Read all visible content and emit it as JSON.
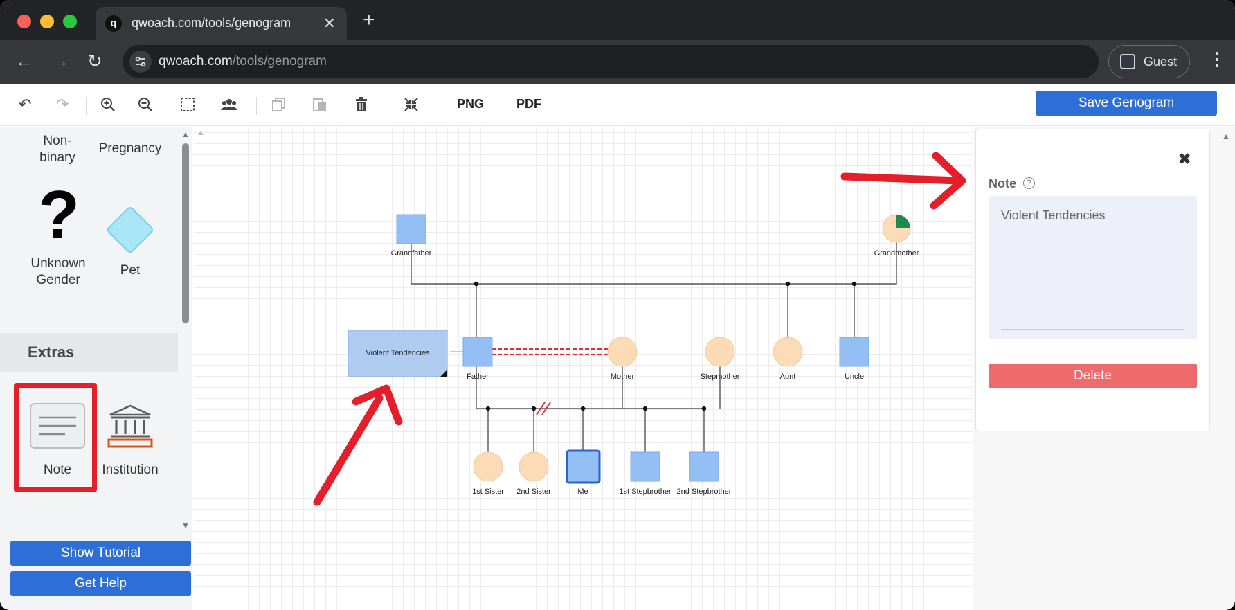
{
  "browser": {
    "tab_title": "qwoach.com/tools/genogram",
    "tab_favicon": "q",
    "url_host": "qwoach.com",
    "url_path": "/tools/genogram",
    "profile_label": "Guest"
  },
  "toolbar": {
    "png_label": "PNG",
    "pdf_label": "PDF",
    "save_label": "Save Genogram",
    "icons": [
      "undo-icon",
      "redo-icon",
      "zoom-in-icon",
      "zoom-out-icon",
      "select-icon",
      "group-icon",
      "copy-icon",
      "paste-icon",
      "trash-icon",
      "fit-icon"
    ]
  },
  "palette": {
    "nonbinary_label": "Non-\nbinary",
    "pregnancy_label": "Pregnancy",
    "unknown_label": "Unknown\nGender",
    "pet_label": "Pet",
    "extras_title": "Extras",
    "note_label": "Note",
    "institution_label": "Institution",
    "tutorial_label": "Show Tutorial",
    "help_label": "Get Help"
  },
  "genogram": {
    "note_text": "Violent Tendencies",
    "people": {
      "grandfather": "Grandfather",
      "grandmother": "Grandmother",
      "father": "Father",
      "mother": "Mother",
      "stepmother": "Stepmother",
      "aunt": "Aunt",
      "uncle": "Uncle",
      "sister1": "1st Sister",
      "sister2": "2nd Sister",
      "me": "Me",
      "stepbrother1": "1st Stepbrother",
      "stepbrother2": "2nd Stepbrother"
    }
  },
  "note_panel": {
    "label": "Note",
    "value": "Violent Tendencies",
    "delete_label": "Delete"
  },
  "colors": {
    "male_fill": "#94bff5",
    "female_fill": "#fbdcb6",
    "accent_blue": "#2d6fd6",
    "delete_red": "#ef6b6b",
    "annotation_red": "#e41e2b"
  }
}
